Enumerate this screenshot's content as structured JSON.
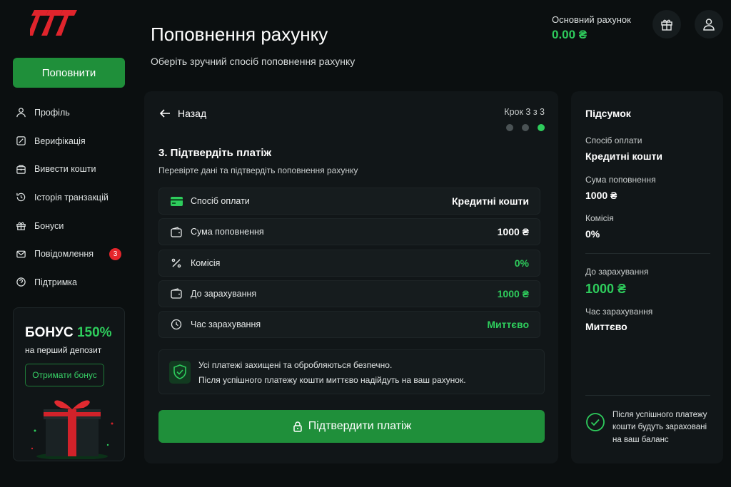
{
  "sidebar": {
    "topup_label": "Поповнити",
    "items": [
      {
        "label": "Профіль",
        "icon": "user-icon"
      },
      {
        "label": "Верифікація",
        "icon": "verification-icon"
      },
      {
        "label": "Вивести кошти",
        "icon": "wallet-withdraw-icon"
      },
      {
        "label": "Історія транзакцій",
        "icon": "history-icon"
      },
      {
        "label": "Бонуси",
        "icon": "gift-icon"
      },
      {
        "label": "Повідомлення",
        "icon": "mail-icon",
        "badge": "3"
      },
      {
        "label": "Підтримка",
        "icon": "help-icon"
      }
    ],
    "promo": {
      "title_prefix": "БОНУС",
      "title_highlight": "150%",
      "subtitle": "на перший депозит",
      "button": "Отримати бонус"
    }
  },
  "header": {
    "title": "Поповнення рахунку",
    "subtitle": "Оберіть зручний спосіб поповнення рахунку",
    "balance_label": "Основний рахунок",
    "balance_value": "0.00 ₴"
  },
  "main": {
    "back_label": "Назад",
    "step_label": "Крок 3 з 3",
    "steps_total": 3,
    "step_current": 3,
    "section_title": "3. Підтвердіть платіж",
    "section_subtitle": "Перевірте дані та підтвердіть поповнення рахунку",
    "rows": [
      {
        "label": "Спосіб оплати",
        "value": "Кредитні кошти",
        "icon": "card-icon"
      },
      {
        "label": "Сума поповнення",
        "value": "1000 ₴",
        "icon": "wallet-icon"
      },
      {
        "label": "Комісія",
        "value": "0%",
        "icon": "percent-icon"
      },
      {
        "label": "До зарахування",
        "value": "1000 ₴",
        "icon": "wallet-icon"
      },
      {
        "label": "Час зарахування",
        "value": "Миттєво",
        "icon": "clock-icon"
      }
    ],
    "secure_line1": "Усі платежі захищені та обробляються безпечно.",
    "secure_line2": "Після успішного платежу кошти миттєво надійдуть на ваш рахунок.",
    "confirm_label": "Підтвердити платіж"
  },
  "summary": {
    "title": "Підсумок",
    "method_label": "Спосіб оплати",
    "method_value": "Кредитні кошти",
    "amount_label": "Сума поповнення",
    "amount_value": "1000 ₴",
    "fee_label": "Комісія",
    "fee_value": "0%",
    "credit_label": "До зарахування",
    "credit_value": "1000 ₴",
    "time_label": "Час зарахування",
    "time_value": "Миттєво",
    "note": "Після успішного платежу кошти будуть зараховані на ваш баланс"
  },
  "colors": {
    "accent": "#1f8f3a",
    "accent_text": "#2ecc5c",
    "badge": "#e5252b",
    "logo": "#e0242c"
  }
}
